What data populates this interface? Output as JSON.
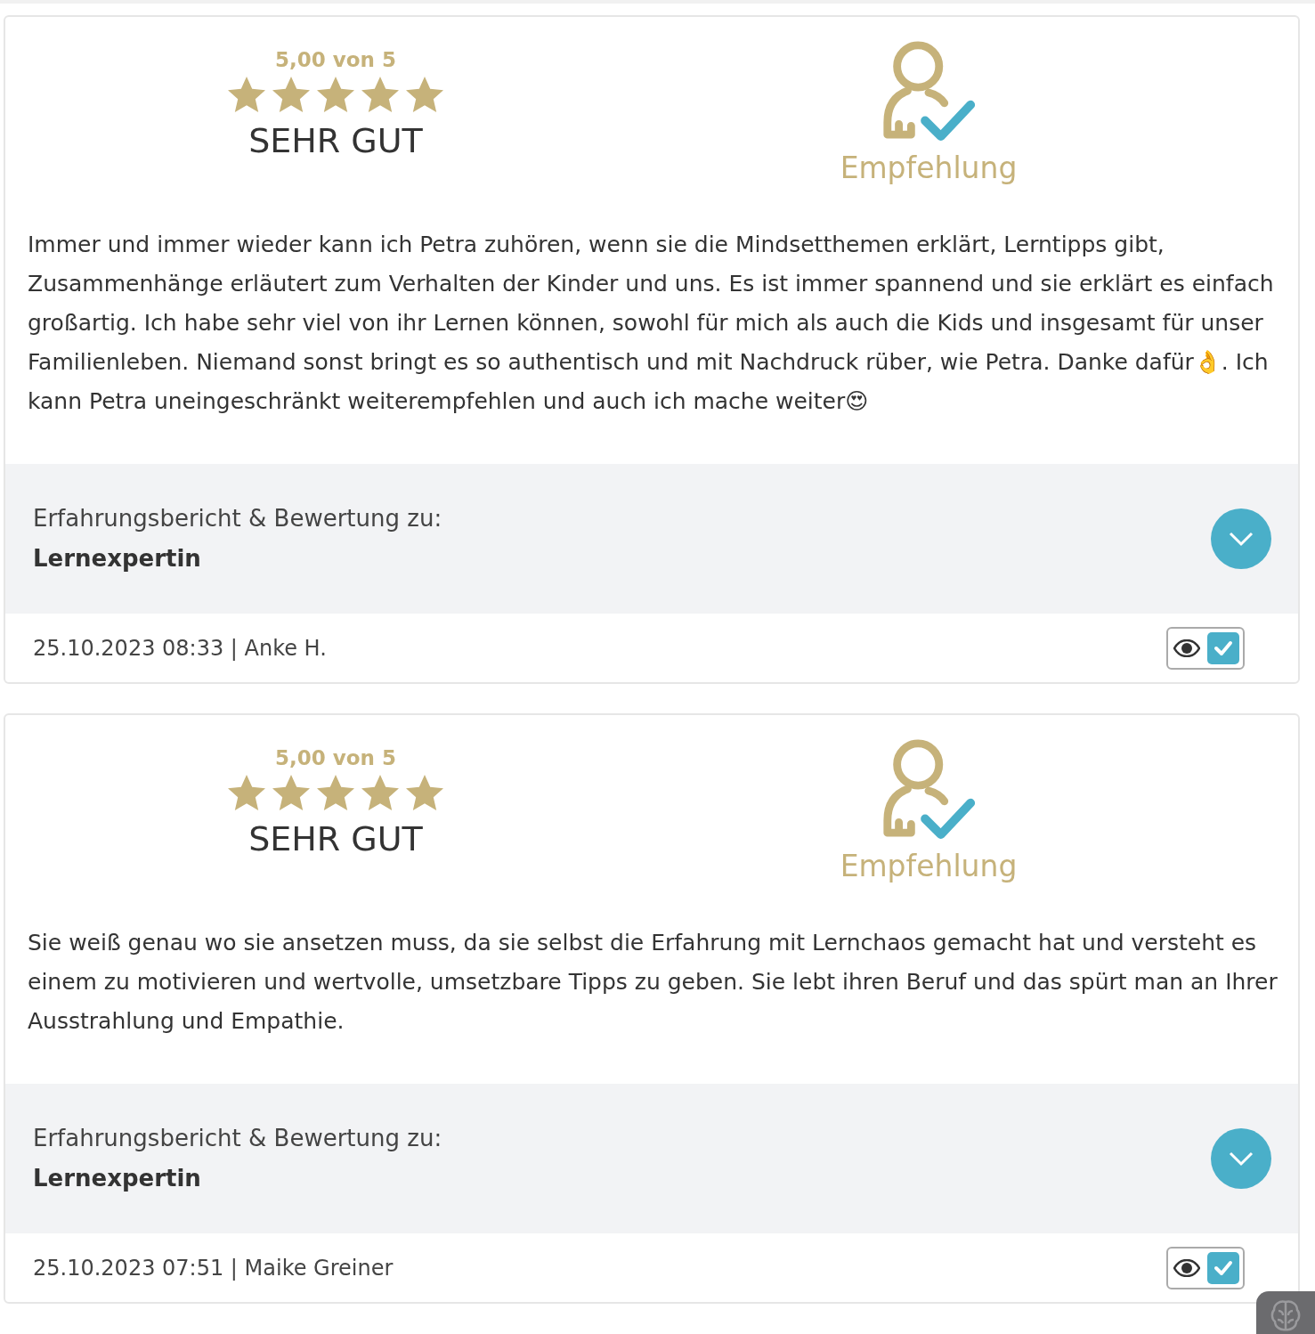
{
  "reviews": [
    {
      "score": "5,00 von 5",
      "stars": 5,
      "verdict": "SEHR GUT",
      "recommendation": "Empfehlung",
      "text": "Immer und immer wieder kann ich Petra zuhören, wenn sie die Mindsetthemen erklärt, Lerntipps gibt, Zusammenhänge erläutert zum Verhalten der Kinder und uns. Es ist immer spannend und sie erklärt es einfach großartig. Ich habe sehr viel von ihr Lernen können, sowohl für mich als auch die Kids und insgesamt für unser Familienleben. Niemand sonst bringt es so authentisch und mit Nachdruck rüber, wie Petra. Danke dafür👌. Ich kann Petra uneingeschränkt weiterempfehlen und auch ich mache weiter😍",
      "subject_label": "Erfahrungsbericht & Bewertung zu:",
      "subject": "Lernexpertin",
      "meta": "25.10.2023 08:33 | Anke H.",
      "checked": true
    },
    {
      "score": "5,00 von 5",
      "stars": 5,
      "verdict": "SEHR GUT",
      "recommendation": "Empfehlung",
      "text": "Sie weiß genau wo sie ansetzen muss, da sie selbst die Erfahrung mit Lernchaos gemacht hat und versteht es einem zu motivieren und wertvolle, umsetzbare Tipps zu geben. Sie lebt ihren Beruf und das spürt man an Ihrer Ausstrahlung und Empathie.",
      "subject_label": "Erfahrungsbericht & Bewertung zu:",
      "subject": "Lernexpertin",
      "meta": "25.10.2023 07:51 | Maike Greiner",
      "checked": true
    }
  ]
}
